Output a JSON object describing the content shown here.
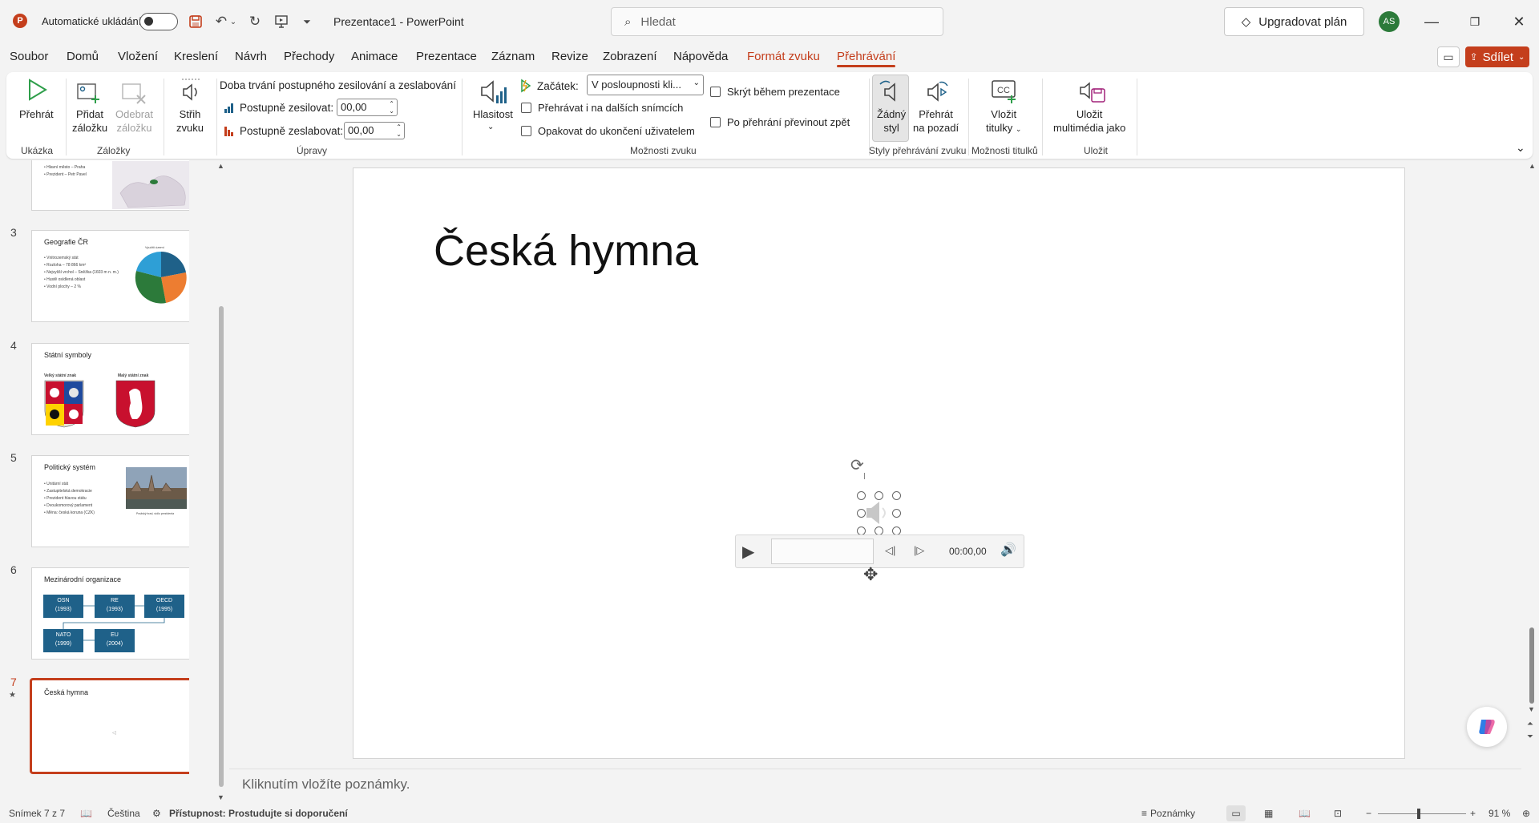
{
  "titlebar": {
    "app_logo": "P",
    "autosave_label": "Automatické ukládání",
    "doc_title": "Prezentace1  -  PowerPoint",
    "search_placeholder": "Hledat",
    "upgrade_label": "Upgradovat plán",
    "avatar_initials": "AS"
  },
  "menu": {
    "tabs": [
      "Soubor",
      "Domů",
      "Vložení",
      "Kreslení",
      "Návrh",
      "Přechody",
      "Animace",
      "Prezentace",
      "Záznam",
      "Revize",
      "Zobrazení",
      "Nápověda",
      "Formát zvuku",
      "Přehrávání"
    ],
    "share_label": "Sdílet"
  },
  "ribbon": {
    "play_label": "Přehrát",
    "preview_group": "Ukázka",
    "add_bookmark": [
      "Přidat",
      "záložku"
    ],
    "remove_bookmark": [
      "Odebrat",
      "záložku"
    ],
    "bookmarks_group": "Záložky",
    "trim": [
      "Střih",
      "zvuku"
    ],
    "fade_heading": "Doba trvání postupného zesilování a zeslabování",
    "fade_in_label": "Postupně zesilovat:",
    "fade_in_value": "00,00",
    "fade_out_label": "Postupně zeslabovat:",
    "fade_out_value": "00,00",
    "editing_group": "Úpravy",
    "volume_label": "Hlasitost",
    "start_label": "Začátek:",
    "start_value": "V posloupnosti kli...",
    "play_across_slides": "Přehrávat i na dalších snímcích",
    "loop_until_stopped": "Opakovat do ukončení uživatelem",
    "hide_during_show": "Skrýt během prezentace",
    "rewind_after_playing": "Po přehrání převinout zpět",
    "audio_options_group": "Možnosti zvuku",
    "no_style": [
      "Žádný",
      "styl"
    ],
    "play_in_background": [
      "Přehrát",
      "na pozadí"
    ],
    "styles_group": "Styly přehrávání zvuku",
    "insert_captions": [
      "Vložit",
      "titulky"
    ],
    "captions_group": "Možnosti titulků",
    "save_media": [
      "Uložit",
      "multimédia jako"
    ],
    "save_group": "Uložit"
  },
  "slides": {
    "s2": {
      "bullets": [
        "Hlavní město – Praha",
        "Prezident – Petr Pavel"
      ]
    },
    "s3": {
      "num": "3",
      "title": "Geografie ČR",
      "bullets": [
        "Vnitrozemský stát",
        "Rozloha – 78 866 km²",
        "Nejvyšší vrchol – Sněžka (1603 m n. m.)",
        "Hustě osídlená oblast",
        "Vodní plochy – 2 %"
      ],
      "pie_title": "Využití území"
    },
    "s4": {
      "num": "4",
      "title": "Státní symboly",
      "label_left": "Velký státní znak",
      "label_right": "Malý státní znak"
    },
    "s5": {
      "num": "5",
      "title": "Politický systém",
      "bullets": [
        "Unitární stát",
        "Zastupitelská demokracie",
        "Prezident hlavou státu",
        "Dvoukomorový parlament",
        "Měna: česká koruna (CZK)"
      ],
      "caption": "Pražský hrad, sídlo prezidenta"
    },
    "s6": {
      "num": "6",
      "title": "Mezinárodní organizace",
      "orgs": [
        [
          "OSN",
          "(1993)"
        ],
        [
          "RE",
          "(1993)"
        ],
        [
          "OECD",
          "(1995)"
        ],
        [
          "NATO",
          "(1999)"
        ],
        [
          "EU",
          "(2004)"
        ]
      ]
    },
    "s7": {
      "num": "7",
      "title": "Česká hymna"
    }
  },
  "slide": {
    "title": "Česká hymna",
    "player_time": "00:00,00"
  },
  "notes_placeholder": "Kliknutím vložíte poznámky.",
  "status": {
    "slide_counter": "Snímek 7 z 7",
    "language": "Čeština",
    "accessibility": "Přístupnost: Prostudujte si doporučení",
    "notes_label": "Poznámky",
    "zoom": "91 %"
  },
  "colors": {
    "accent": "#c43e1c",
    "org_box": "#1f6189"
  }
}
